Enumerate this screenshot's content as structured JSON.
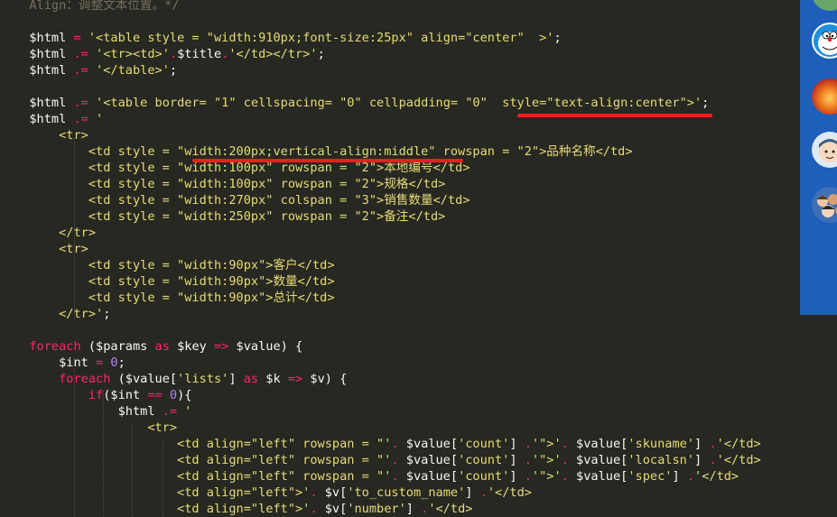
{
  "editor": {
    "lines": [
      [
        {
          "t": "  Align：调整文本位置。*/",
          "c": "c"
        }
      ],
      [],
      [
        {
          "t": "  $html",
          "c": "v"
        },
        {
          "t": " = ",
          "c": "op"
        },
        {
          "t": "'<table style = \"width:910px;font-size:25px\" align=\"center\"  >'",
          "c": "s"
        },
        {
          "t": ";",
          "c": "v"
        }
      ],
      [
        {
          "t": "  $html",
          "c": "v"
        },
        {
          "t": " .= ",
          "c": "op"
        },
        {
          "t": "'<tr><td>'",
          "c": "s"
        },
        {
          "t": ".",
          "c": "op"
        },
        {
          "t": "$title",
          "c": "v"
        },
        {
          "t": ".",
          "c": "op"
        },
        {
          "t": "'</td></tr>'",
          "c": "s"
        },
        {
          "t": ";",
          "c": "v"
        }
      ],
      [
        {
          "t": "  $html",
          "c": "v"
        },
        {
          "t": " .= ",
          "c": "op"
        },
        {
          "t": "'</table>'",
          "c": "s"
        },
        {
          "t": ";",
          "c": "v"
        }
      ],
      [],
      [
        {
          "t": "  $html",
          "c": "v"
        },
        {
          "t": " .= ",
          "c": "op"
        },
        {
          "t": "'<table border= \"1\" cellspacing= \"0\" cellpadding= \"0\"  style=\"text-align:center\">'",
          "c": "s"
        },
        {
          "t": ";",
          "c": "v"
        }
      ],
      [
        {
          "t": "  $html",
          "c": "v"
        },
        {
          "t": " .= ",
          "c": "op"
        },
        {
          "t": "'",
          "c": "s"
        }
      ],
      [
        {
          "t": "      <tr>",
          "c": "s"
        }
      ],
      [
        {
          "t": "          <td style = \"width:200px;vertical-align:middle\" rowspan = \"2\">品种名称</td>",
          "c": "s"
        }
      ],
      [
        {
          "t": "          <td style = \"width:100px\" rowspan = \"2\">本地编号</td>",
          "c": "s"
        }
      ],
      [
        {
          "t": "          <td style = \"width:100px\" rowspan = \"2\">规格</td>",
          "c": "s"
        }
      ],
      [
        {
          "t": "          <td style = \"width:270px\" colspan = \"3\">销售数量</td>",
          "c": "s"
        }
      ],
      [
        {
          "t": "          <td style = \"width:250px\" rowspan = \"2\">备注</td>",
          "c": "s"
        }
      ],
      [
        {
          "t": "      </tr>",
          "c": "s"
        }
      ],
      [
        {
          "t": "      <tr>",
          "c": "s"
        }
      ],
      [
        {
          "t": "          <td style = \"width:90px\">客户</td>",
          "c": "s"
        }
      ],
      [
        {
          "t": "          <td style = \"width:90px\">数量</td>",
          "c": "s"
        }
      ],
      [
        {
          "t": "          <td style = \"width:90px\">总计</td>",
          "c": "s"
        }
      ],
      [
        {
          "t": "      </tr>'",
          "c": "s"
        },
        {
          "t": ";",
          "c": "v"
        }
      ],
      [],
      [
        {
          "t": "  foreach",
          "c": "op"
        },
        {
          "t": " ($params ",
          "c": "v"
        },
        {
          "t": "as",
          "c": "op"
        },
        {
          "t": " $key ",
          "c": "v"
        },
        {
          "t": "=>",
          "c": "op"
        },
        {
          "t": " $value) {",
          "c": "v"
        }
      ],
      [
        {
          "t": "      $int",
          "c": "v"
        },
        {
          "t": " = ",
          "c": "op"
        },
        {
          "t": "0",
          "c": "n"
        },
        {
          "t": ";",
          "c": "v"
        }
      ],
      [
        {
          "t": "      foreach",
          "c": "op"
        },
        {
          "t": " ($value[",
          "c": "v"
        },
        {
          "t": "'lists'",
          "c": "s"
        },
        {
          "t": "] ",
          "c": "v"
        },
        {
          "t": "as",
          "c": "op"
        },
        {
          "t": " $k ",
          "c": "v"
        },
        {
          "t": "=>",
          "c": "op"
        },
        {
          "t": " $v) {",
          "c": "v"
        }
      ],
      [
        {
          "t": "          if",
          "c": "op"
        },
        {
          "t": "($int ",
          "c": "v"
        },
        {
          "t": "==",
          "c": "op"
        },
        {
          "t": " ",
          "c": "v"
        },
        {
          "t": "0",
          "c": "n"
        },
        {
          "t": "){",
          "c": "v"
        }
      ],
      [
        {
          "t": "              $html",
          "c": "v"
        },
        {
          "t": " .= ",
          "c": "op"
        },
        {
          "t": "'",
          "c": "s"
        }
      ],
      [
        {
          "t": "                  <tr>",
          "c": "s"
        }
      ],
      [
        {
          "t": "                      <td align=\"left\" rowspan = \"'",
          "c": "s"
        },
        {
          "t": ". ",
          "c": "op"
        },
        {
          "t": "$value[",
          "c": "v"
        },
        {
          "t": "'count'",
          "c": "s"
        },
        {
          "t": "] ",
          "c": "v"
        },
        {
          "t": ".",
          "c": "op"
        },
        {
          "t": "'\">'",
          "c": "s"
        },
        {
          "t": ". ",
          "c": "op"
        },
        {
          "t": "$value[",
          "c": "v"
        },
        {
          "t": "'skuname'",
          "c": "s"
        },
        {
          "t": "] ",
          "c": "v"
        },
        {
          "t": ".",
          "c": "op"
        },
        {
          "t": "'</td>",
          "c": "s"
        }
      ],
      [
        {
          "t": "                      <td align=\"left\" rowspan = \"'",
          "c": "s"
        },
        {
          "t": ". ",
          "c": "op"
        },
        {
          "t": "$value[",
          "c": "v"
        },
        {
          "t": "'count'",
          "c": "s"
        },
        {
          "t": "] ",
          "c": "v"
        },
        {
          "t": ".",
          "c": "op"
        },
        {
          "t": "'\">'",
          "c": "s"
        },
        {
          "t": ". ",
          "c": "op"
        },
        {
          "t": "$value[",
          "c": "v"
        },
        {
          "t": "'localsn'",
          "c": "s"
        },
        {
          "t": "] ",
          "c": "v"
        },
        {
          "t": ".",
          "c": "op"
        },
        {
          "t": "'</td>",
          "c": "s"
        }
      ],
      [
        {
          "t": "                      <td align=\"left\" rowspan = \"'",
          "c": "s"
        },
        {
          "t": ". ",
          "c": "op"
        },
        {
          "t": "$value[",
          "c": "v"
        },
        {
          "t": "'count'",
          "c": "s"
        },
        {
          "t": "] ",
          "c": "v"
        },
        {
          "t": ".",
          "c": "op"
        },
        {
          "t": "'\">'",
          "c": "s"
        },
        {
          "t": ". ",
          "c": "op"
        },
        {
          "t": "$value[",
          "c": "v"
        },
        {
          "t": "'spec'",
          "c": "s"
        },
        {
          "t": "] ",
          "c": "v"
        },
        {
          "t": ".",
          "c": "op"
        },
        {
          "t": "'</td>",
          "c": "s"
        }
      ],
      [
        {
          "t": "                      <td align=\"left\">'",
          "c": "s"
        },
        {
          "t": ". ",
          "c": "op"
        },
        {
          "t": "$v[",
          "c": "v"
        },
        {
          "t": "'to_custom_name'",
          "c": "s"
        },
        {
          "t": "] ",
          "c": "v"
        },
        {
          "t": ".",
          "c": "op"
        },
        {
          "t": "'</td>",
          "c": "s"
        }
      ],
      [
        {
          "t": "                      <td align=\"left\">'",
          "c": "s"
        },
        {
          "t": ". ",
          "c": "op"
        },
        {
          "t": "$v[",
          "c": "v"
        },
        {
          "t": "'number'",
          "c": "s"
        },
        {
          "t": "] ",
          "c": "v"
        },
        {
          "t": ".",
          "c": "op"
        },
        {
          "t": "'</td>",
          "c": "s"
        }
      ]
    ]
  },
  "annotations": [
    {
      "name": "highlight-text-align-underline",
      "color": "#e8211c"
    },
    {
      "name": "highlight-vertical-align-underline",
      "color": "#e8211c"
    }
  ],
  "sidebar": {
    "color": "#1d5fba",
    "avatars": [
      "avatar-partial",
      "avatar-doraemon",
      "avatar-sunset",
      "avatar-cartoon-face",
      "avatar-group"
    ]
  }
}
